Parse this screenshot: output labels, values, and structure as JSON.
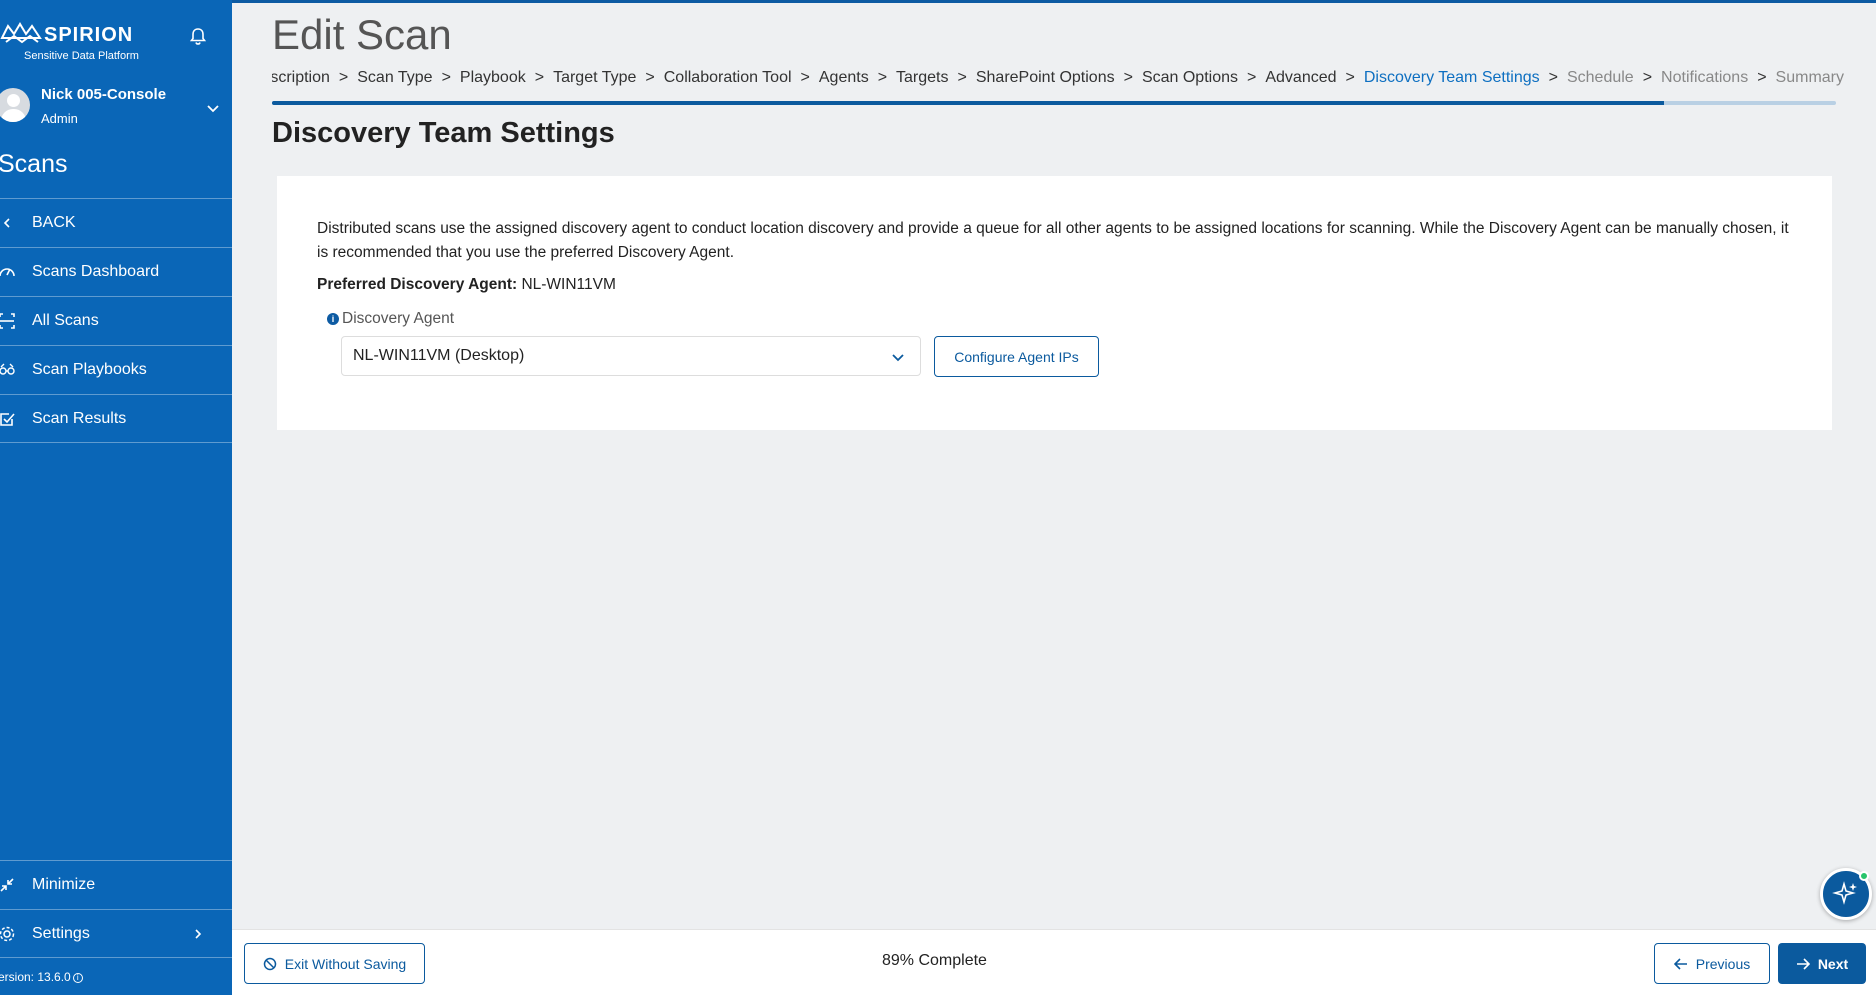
{
  "sidebar": {
    "brand": "SPIRION",
    "brand_sub": "Sensitive Data Platform",
    "user_name": "Nick 005-Console",
    "user_role": "Admin",
    "section_title": "Scans",
    "items": [
      {
        "label": "BACK",
        "icon": "chevron-left-icon"
      },
      {
        "label": "Scans Dashboard",
        "icon": "dashboard-gauge-icon"
      },
      {
        "label": "All Scans",
        "icon": "all-scans-icon"
      },
      {
        "label": "Scan Playbooks",
        "icon": "playbook-icon"
      },
      {
        "label": "Scan Results",
        "icon": "checkbox-results-icon"
      }
    ],
    "bottom_items": [
      {
        "label": "Minimize",
        "icon": "minimize-arrows-icon"
      },
      {
        "label": "Settings",
        "icon": "gear-icon"
      }
    ],
    "version": "ersion: 13.6.0"
  },
  "header": {
    "title": "Edit Scan",
    "steps": [
      {
        "label": "d Description",
        "state": "done"
      },
      {
        "label": "Scan Type",
        "state": "done"
      },
      {
        "label": "Playbook",
        "state": "done"
      },
      {
        "label": "Target Type",
        "state": "done"
      },
      {
        "label": "Collaboration Tool",
        "state": "done"
      },
      {
        "label": "Agents",
        "state": "done"
      },
      {
        "label": "Targets",
        "state": "done"
      },
      {
        "label": "SharePoint Options",
        "state": "done"
      },
      {
        "label": "Scan Options",
        "state": "done"
      },
      {
        "label": "Advanced",
        "state": "done"
      },
      {
        "label": "Discovery Team Settings",
        "state": "active"
      },
      {
        "label": "Schedule",
        "state": "future"
      },
      {
        "label": "Notifications",
        "state": "future"
      },
      {
        "label": "Summary",
        "state": "future"
      }
    ],
    "step_separator": ">",
    "progress_fraction": 0.89
  },
  "main": {
    "section_heading": "Discovery Team Settings",
    "description": "Distributed scans use the assigned discovery agent to conduct location discovery and provide a queue for all other agents to be assigned locations for scanning. While the Discovery Agent can be manually chosen, it is recommended that you use the preferred Discovery Agent.",
    "preferred_label": "Preferred Discovery Agent:",
    "preferred_value": "NL-WIN11VM",
    "agent_field_label": "Discovery Agent",
    "agent_selected": "NL-WIN11VM (Desktop)",
    "configure_button": "Configure Agent IPs"
  },
  "footer": {
    "exit_label": "Exit Without Saving",
    "complete_text": "89% Complete",
    "previous_label": "Previous",
    "next_label": "Next"
  },
  "colors": {
    "sidebar_bg": "#0a66b7",
    "accent": "#0b5a9e",
    "active_step": "#0d6fc1"
  }
}
